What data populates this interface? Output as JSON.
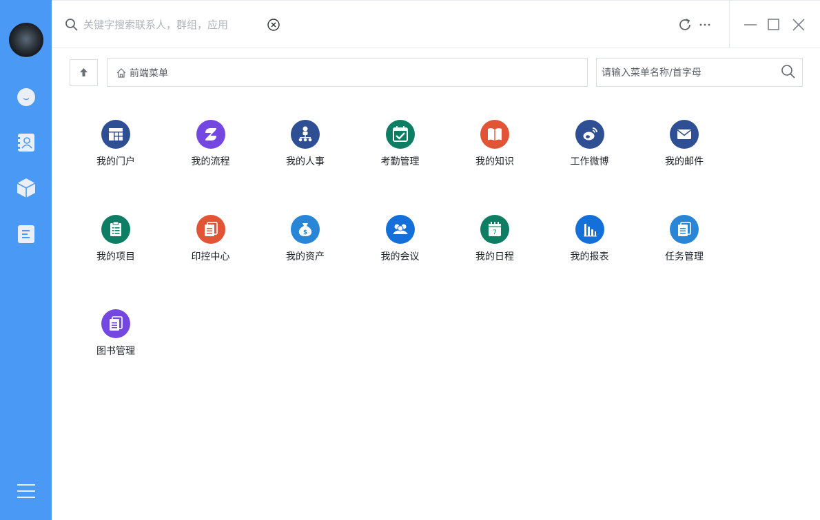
{
  "search": {
    "placeholder": "关键字搜索联系人，群组，应用"
  },
  "breadcrumb": {
    "label": "前端菜单"
  },
  "menu_search": {
    "placeholder": "请输入菜单名称/首字母"
  },
  "colors": {
    "sidebar": "#4a9af5"
  },
  "apps": [
    {
      "label": "我的门户",
      "color": "#2e4f93",
      "icon": "portal-icon"
    },
    {
      "label": "我的流程",
      "color": "#7448e0",
      "icon": "flow-icon"
    },
    {
      "label": "我的人事",
      "color": "#2e4f93",
      "icon": "org-icon"
    },
    {
      "label": "考勤管理",
      "color": "#0d7d63",
      "icon": "calendar-check-icon"
    },
    {
      "label": "我的知识",
      "color": "#e25436",
      "icon": "book-icon"
    },
    {
      "label": "工作微博",
      "color": "#2e4f93",
      "icon": "weibo-icon"
    },
    {
      "label": "我的邮件",
      "color": "#2e4f93",
      "icon": "mail-icon"
    },
    {
      "label": "我的项目",
      "color": "#0d7d63",
      "icon": "clipboard-icon"
    },
    {
      "label": "印控中心",
      "color": "#e25436",
      "icon": "documents-icon"
    },
    {
      "label": "我的资产",
      "color": "#2986d6",
      "icon": "money-bag-icon"
    },
    {
      "label": "我的会议",
      "color": "#1470d8",
      "icon": "people-icon"
    },
    {
      "label": "我的日程",
      "color": "#0d7d63",
      "icon": "calendar-day-icon",
      "day": "7"
    },
    {
      "label": "我的报表",
      "color": "#1470d8",
      "icon": "bar-chart-icon"
    },
    {
      "label": "任务管理",
      "color": "#2986d6",
      "icon": "documents-icon"
    },
    {
      "label": "图书管理",
      "color": "#7448e0",
      "icon": "documents-icon"
    }
  ]
}
